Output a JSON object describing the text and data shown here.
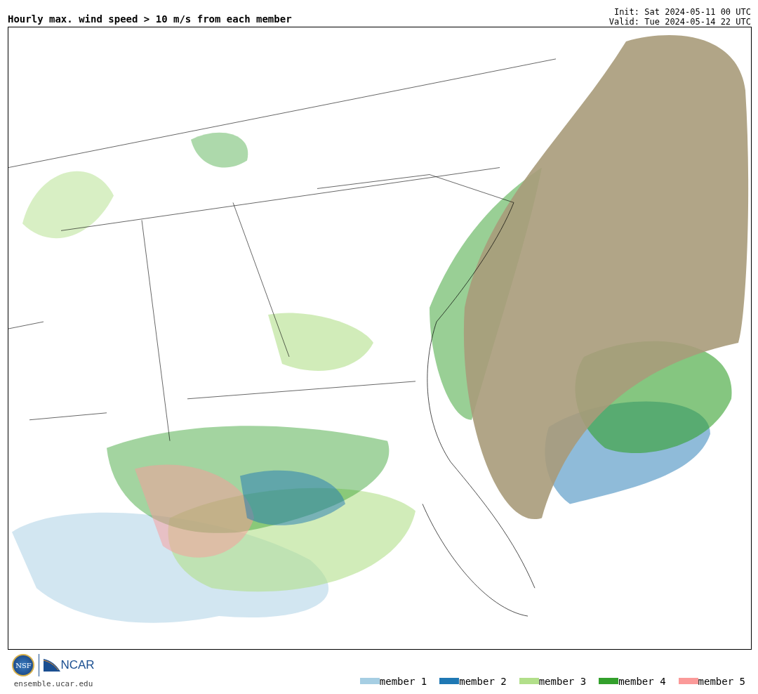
{
  "title": "Hourly max. wind speed > 10 m/s from each member",
  "init": "Init: Sat 2024-05-11 00 UTC",
  "valid": "Valid: Tue 2024-05-14 22 UTC",
  "logos": {
    "nsf": "NSF",
    "ncar": "NCAR"
  },
  "site": "ensemble.ucar.edu",
  "legend": [
    {
      "label": "member 1",
      "color": "#a6cee3"
    },
    {
      "label": "member 2",
      "color": "#1f78b4"
    },
    {
      "label": "member 3",
      "color": "#b2df8a"
    },
    {
      "label": "member 4",
      "color": "#33a02c"
    },
    {
      "label": "member 5",
      "color": "#fb9a99"
    }
  ]
}
